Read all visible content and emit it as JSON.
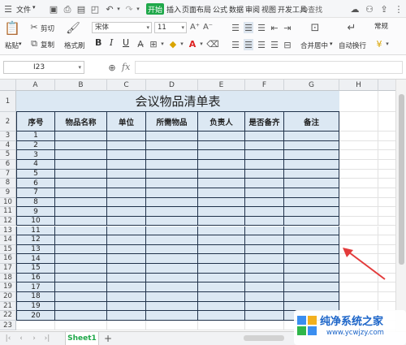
{
  "menubar": {
    "file_label": "文件",
    "start_tab": "开始",
    "tabs": [
      "插入",
      "页面布局",
      "公式",
      "数据",
      "审阅",
      "视图",
      "开发工具"
    ],
    "search_label": "Q查找"
  },
  "ribbon": {
    "paste_label": "粘贴",
    "cut_label": "剪切",
    "copy_label": "复制",
    "format_painter_label": "格式刷",
    "font_name": "宋体",
    "font_size": "11",
    "merge_label": "合并居中",
    "wrap_label": "自动换行",
    "number_format": "常规",
    "bold_label": "B",
    "italic_label": "I",
    "underline_label": "U"
  },
  "formula_bar": {
    "cell_ref": "I23",
    "fx_label": "fx"
  },
  "columns": [
    "A",
    "B",
    "C",
    "D",
    "E",
    "F",
    "G",
    "H"
  ],
  "sheet": {
    "title": "会议物品清单表",
    "headers": [
      "序号",
      "物品名称",
      "单位",
      "所需物品",
      "负责人",
      "是否备齐",
      "备注"
    ],
    "row_labels": [
      "1",
      "2",
      "3",
      "4",
      "5",
      "6",
      "7",
      "8",
      "9",
      "10",
      "11",
      "12",
      "13",
      "14",
      "15",
      "16",
      "17",
      "18",
      "19",
      "20",
      "21",
      "22",
      "23"
    ],
    "serials": [
      "1",
      "2",
      "3",
      "4",
      "5",
      "6",
      "7",
      "8",
      "9",
      "10",
      "11",
      "12",
      "13",
      "14",
      "15",
      "16",
      "17",
      "18",
      "19",
      "20"
    ]
  },
  "tabs_bar": {
    "sheet_name": "Sheet1",
    "add_label": "+"
  },
  "watermark": {
    "name": "纯净系统之家",
    "url": "www.ycwjzy.com"
  },
  "colors": {
    "accent_green": "#1fa84a",
    "cell_fill": "#dce8f3",
    "border": "#20324a",
    "arrow_red": "#e33b3b"
  }
}
